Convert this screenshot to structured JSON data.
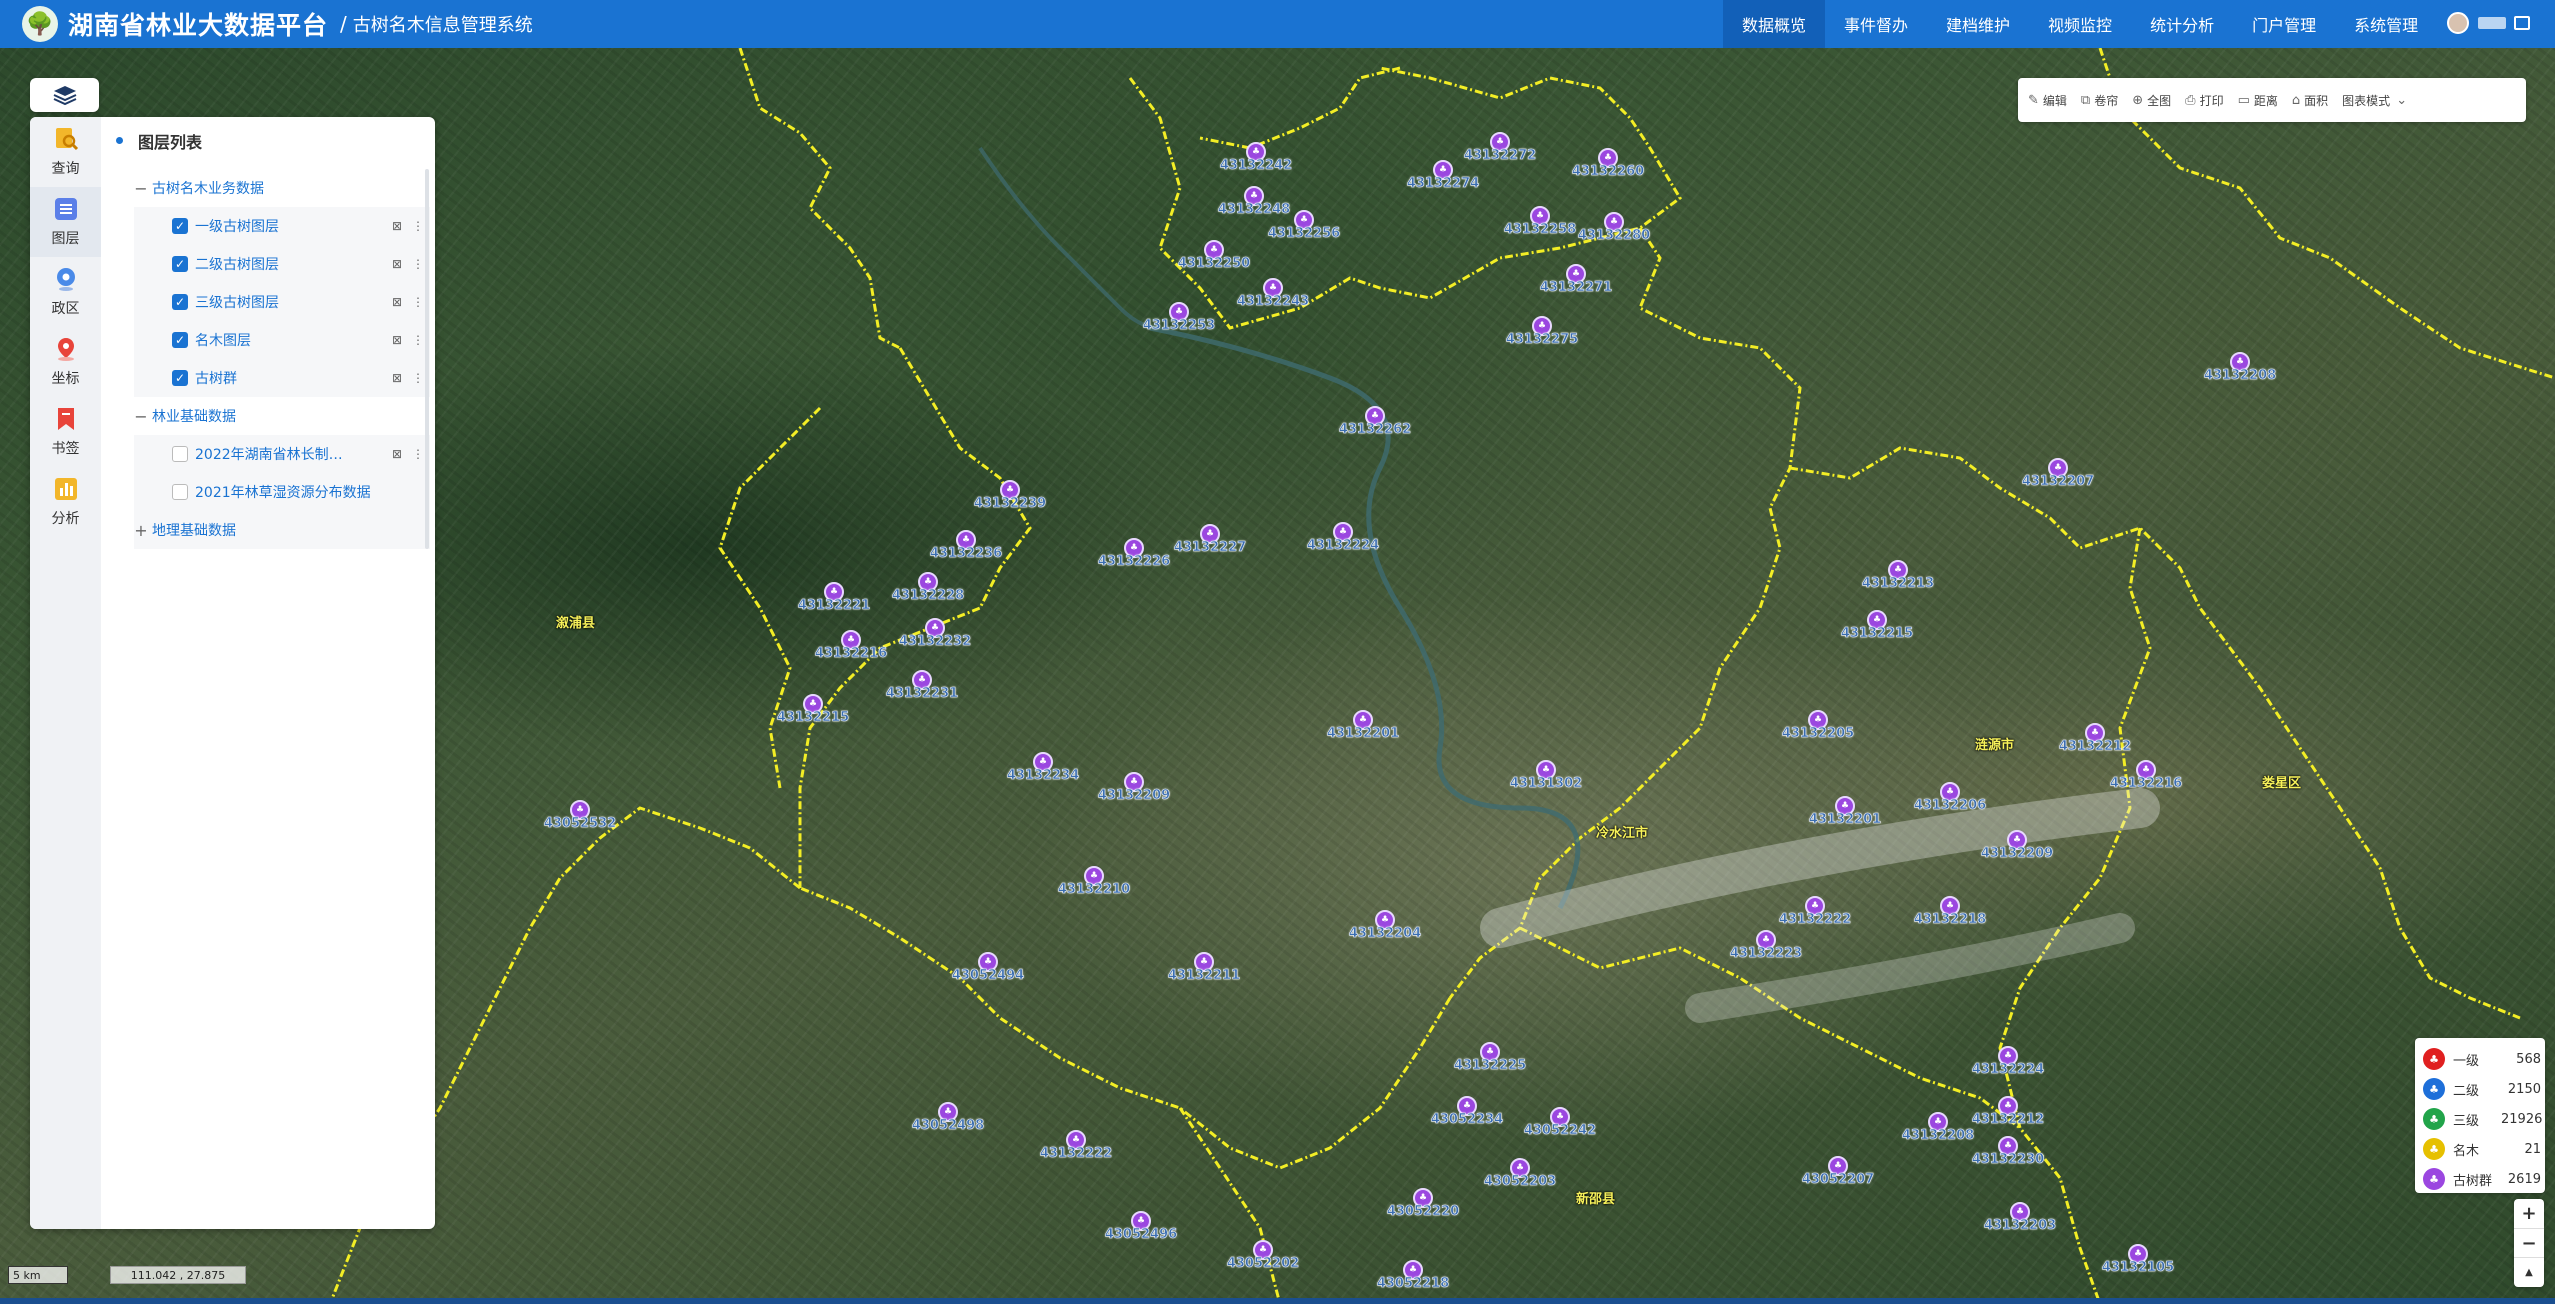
{
  "header": {
    "app_title": "湖南省林业大数据平台",
    "separator": "/",
    "sub_title": "古树名木信息管理系统",
    "nav": [
      "数据概览",
      "事件督办",
      "建档维护",
      "视频监控",
      "统计分析",
      "门户管理",
      "系统管理"
    ],
    "active_nav": "数据概览"
  },
  "rail": [
    {
      "label": "查询",
      "icon": "search-icon"
    },
    {
      "label": "图层",
      "icon": "layers-icon"
    },
    {
      "label": "政区",
      "icon": "region-pin-icon"
    },
    {
      "label": "坐标",
      "icon": "coordinate-pin-icon"
    },
    {
      "label": "书签",
      "icon": "bookmark-icon"
    },
    {
      "label": "分析",
      "icon": "chart-icon"
    }
  ],
  "layer_panel": {
    "title": "图层列表",
    "groups": [
      {
        "label": "古树名木业务数据",
        "toggle": "−",
        "items": [
          {
            "label": "一级古树图层",
            "checked": true
          },
          {
            "label": "二级古树图层",
            "checked": true
          },
          {
            "label": "三级古树图层",
            "checked": true
          },
          {
            "label": "名木图层",
            "checked": true
          },
          {
            "label": "古树群",
            "checked": true
          }
        ]
      },
      {
        "label": "林业基础数据",
        "toggle": "−",
        "items": [
          {
            "label": "2022年湖南省林长制…",
            "checked": false
          },
          {
            "label": "2021年林草湿资源分布数据",
            "checked": false
          }
        ]
      },
      {
        "label": "地理基础数据",
        "toggle": "+",
        "items": []
      }
    ]
  },
  "toolbar": {
    "items": [
      {
        "label": "编辑",
        "icon": "edit-icon"
      },
      {
        "label": "卷帘",
        "icon": "swipe-icon"
      },
      {
        "label": "全图",
        "icon": "globe-icon"
      },
      {
        "label": "打印",
        "icon": "print-icon"
      },
      {
        "label": "距离",
        "icon": "ruler-icon"
      },
      {
        "label": "面积",
        "icon": "area-icon"
      }
    ],
    "mode": "图表模式"
  },
  "legend": [
    {
      "label": "一级",
      "count": "568",
      "color": "#e02020"
    },
    {
      "label": "二级",
      "count": "2150",
      "color": "#1e6fd9"
    },
    {
      "label": "三级",
      "count": "21926",
      "color": "#22a44a"
    },
    {
      "label": "名木",
      "count": "21",
      "color": "#e6c000"
    },
    {
      "label": "古树群",
      "count": "2619",
      "color": "#9b47e0"
    }
  ],
  "zoom": {
    "in": "+",
    "out": "−",
    "reset": "▲"
  },
  "scale": "5 km",
  "coordinates": "111.042 , 27.875",
  "place_names": [
    "溆浦县",
    "涟源市",
    "冷水江市",
    "娄星区",
    "新邵县"
  ],
  "markers": [
    "43132242",
    "43132248",
    "43132256",
    "43132250",
    "43132243",
    "43132253",
    "43132274",
    "43132272",
    "43132260",
    "43132258",
    "43132280",
    "43132271",
    "43132275",
    "43132262",
    "43132208",
    "43132207",
    "43132239",
    "43132226",
    "43132227",
    "43132224",
    "43132236",
    "43132221",
    "43132228",
    "43132216",
    "43132232",
    "43132231",
    "43132215",
    "43132213",
    "43132215",
    "43052532",
    "43132234",
    "43132209",
    "43132201",
    "43131302",
    "43132205",
    "43132201",
    "43132212",
    "43132206",
    "43132216",
    "43132209",
    "43132210",
    "43132204",
    "43132222",
    "43132223",
    "43132218",
    "43052494",
    "43132211",
    "43132225",
    "43132224",
    "43052498",
    "43132222",
    "43052234",
    "43052242",
    "43052203",
    "43052207",
    "43132208",
    "43132212",
    "43132230",
    "43052220",
    "43132203",
    "43052496",
    "43052202",
    "43052218",
    "43132105"
  ]
}
